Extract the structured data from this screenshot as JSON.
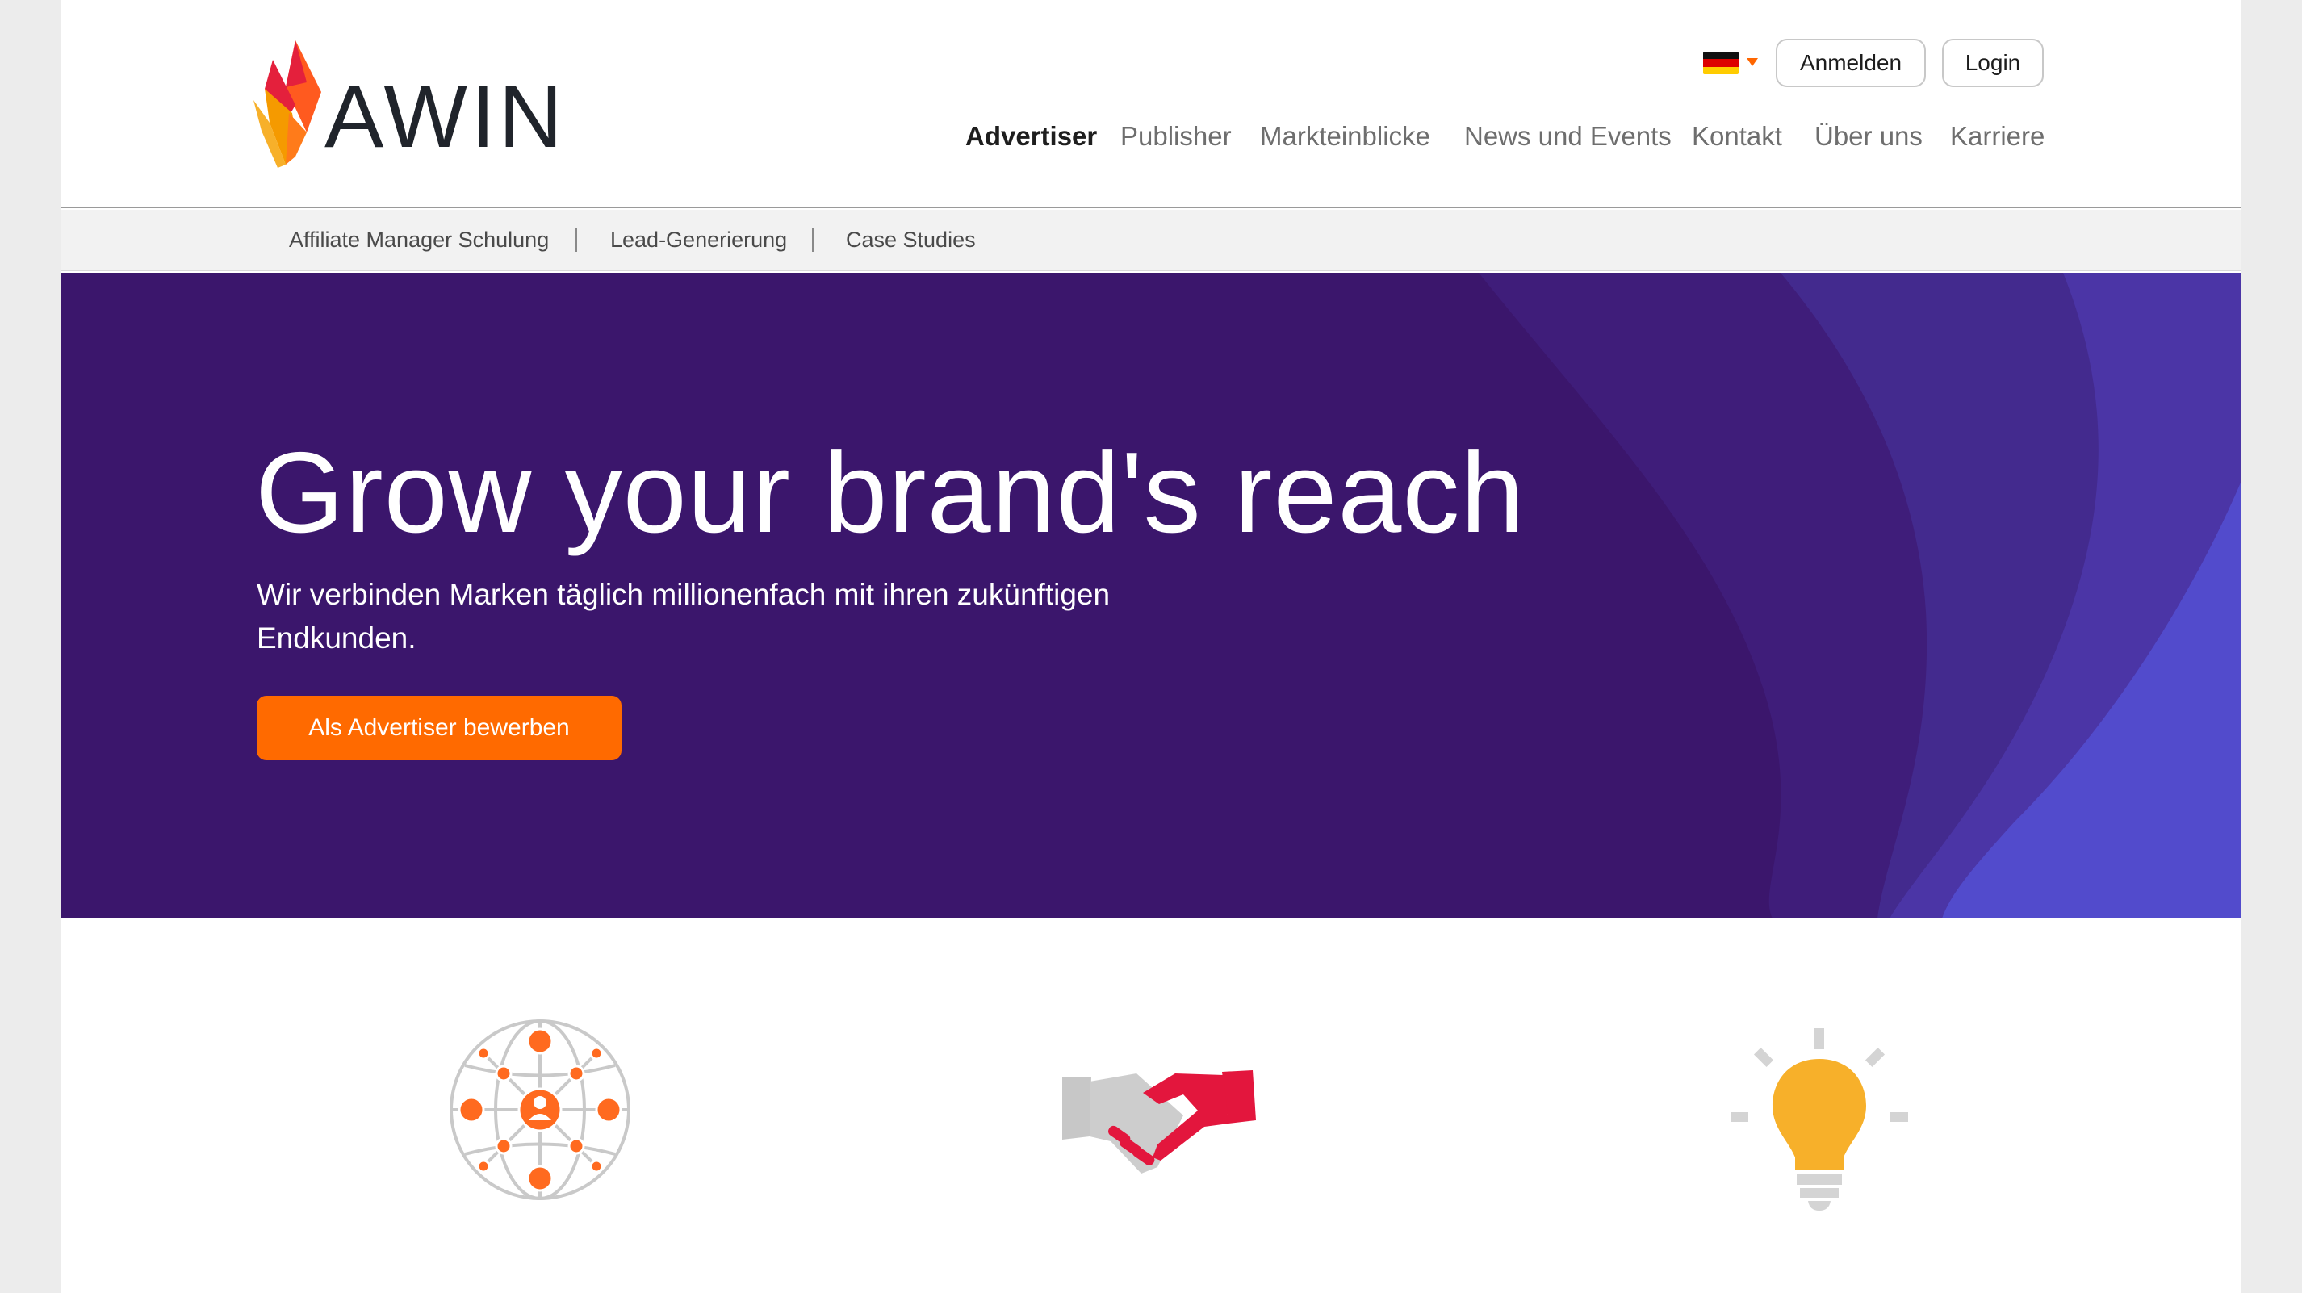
{
  "brand": {
    "name": "AWIN"
  },
  "header": {
    "language": {
      "icon": "german-flag-icon",
      "current": "DE"
    },
    "buttons": {
      "anmelden": "Anmelden",
      "login": "Login"
    },
    "nav": [
      "Advertiser",
      "Publisher",
      "Markteinblicke",
      "News und Events",
      "Kontakt",
      "Über uns",
      "Karriere"
    ],
    "active_nav": "Advertiser"
  },
  "subnav": [
    "Affiliate Manager Schulung",
    "Lead-Generierung",
    "Case Studies"
  ],
  "hero": {
    "title": "Grow your brand's reach",
    "subtitle": "Wir verbinden Marken täglich millionenfach mit ihren zukünftigen Endkunden.",
    "cta": "Als Advertiser bewerben"
  },
  "features": [
    {
      "icon": "global-network-icon"
    },
    {
      "icon": "handshake-icon"
    },
    {
      "icon": "lightbulb-icon"
    }
  ],
  "colors": {
    "hero_bg": "#3b166c",
    "accent_orange": "#ff6a00",
    "handshake_red": "#e3163d",
    "bulb_yellow": "#f7b02a"
  }
}
